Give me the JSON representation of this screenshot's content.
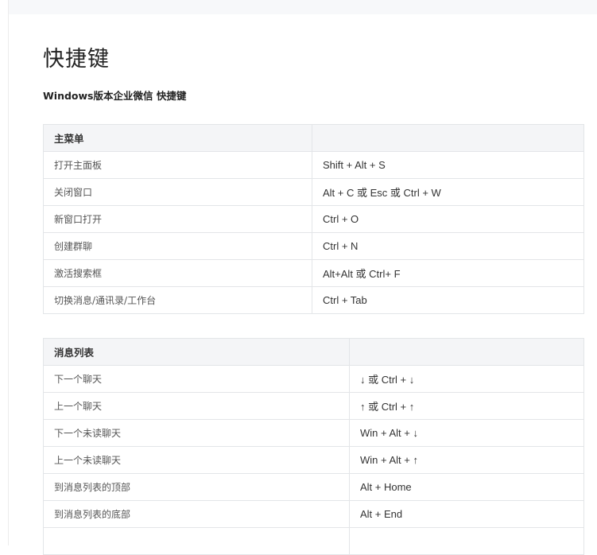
{
  "page": {
    "title": "快捷键",
    "subtitle": "Windows版本企业微信 快捷键"
  },
  "tables": [
    {
      "header": [
        "主菜单",
        ""
      ],
      "rows": [
        [
          "打开主面板",
          "Shift + Alt + S"
        ],
        [
          "关闭窗口",
          "Alt + C 或 Esc 或 Ctrl + W"
        ],
        [
          "新窗口打开",
          "Ctrl + O"
        ],
        [
          "创建群聊",
          "Ctrl + N"
        ],
        [
          "激活搜索框",
          "Alt+Alt 或 Ctrl+ F"
        ],
        [
          "切换消息/通讯录/工作台",
          "Ctrl + Tab"
        ]
      ]
    },
    {
      "header": [
        "消息列表",
        ""
      ],
      "rows": [
        [
          "下一个聊天",
          "↓ 或 Ctrl + ↓"
        ],
        [
          "上一个聊天",
          "↑ 或 Ctrl + ↑"
        ],
        [
          "下一个未读聊天",
          "Win + Alt + ↓"
        ],
        [
          "上一个未读聊天",
          "Win + Alt + ↑"
        ],
        [
          "到消息列表的顶部",
          "Alt + Home"
        ],
        [
          "到消息列表的底部",
          "Alt + End"
        ],
        [
          "",
          ""
        ]
      ]
    }
  ]
}
